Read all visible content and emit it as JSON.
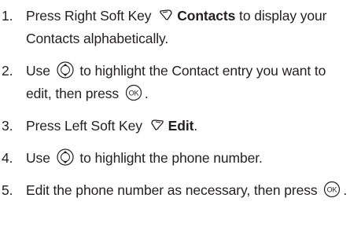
{
  "steps": [
    {
      "number": "1.",
      "segments": [
        {
          "type": "text",
          "text": "Press Right Soft Key "
        },
        {
          "type": "icon",
          "icon": "right-soft-key-icon"
        },
        {
          "type": "bold",
          "text": "Contacts"
        },
        {
          "type": "text",
          "text": " to display your Contacts alphabetically."
        }
      ]
    },
    {
      "number": "2.",
      "segments": [
        {
          "type": "text",
          "text": "Use "
        },
        {
          "type": "icon",
          "icon": "navigation-key-icon"
        },
        {
          "type": "text",
          "text": " to highlight the Contact entry you want to edit, then press "
        },
        {
          "type": "icon",
          "icon": "ok-key-icon"
        },
        {
          "type": "text",
          "text": "."
        }
      ]
    },
    {
      "number": "3.",
      "segments": [
        {
          "type": "text",
          "text": "Press Left Soft Key "
        },
        {
          "type": "icon",
          "icon": "left-soft-key-icon"
        },
        {
          "type": "bold",
          "text": "Edit"
        },
        {
          "type": "text",
          "text": "."
        }
      ]
    },
    {
      "number": "4.",
      "segments": [
        {
          "type": "text",
          "text": "Use "
        },
        {
          "type": "icon",
          "icon": "navigation-key-icon"
        },
        {
          "type": "text",
          "text": " to highlight the phone number."
        }
      ]
    },
    {
      "number": "5.",
      "segments": [
        {
          "type": "text",
          "text": "Edit the phone number as necessary, then press "
        },
        {
          "type": "icon",
          "icon": "ok-key-icon"
        },
        {
          "type": "text",
          "text": "."
        }
      ]
    }
  ]
}
